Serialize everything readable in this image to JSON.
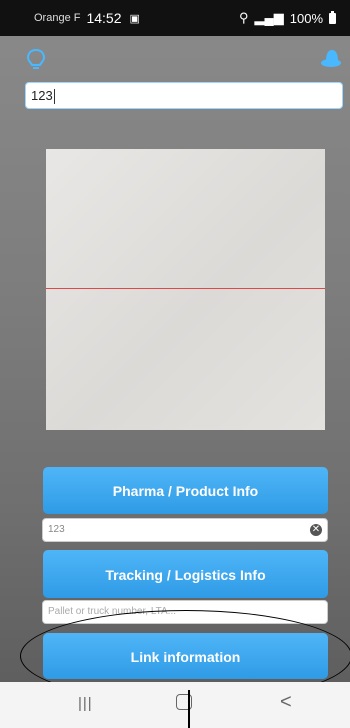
{
  "status_bar": {
    "carrier": "Orange F",
    "time": "14:52",
    "notification_icon": "notification-icon",
    "battery": "100%"
  },
  "header": {
    "left_icon": "lightbulb-icon",
    "right_icon": "hat-icon"
  },
  "code_input": {
    "value": "123"
  },
  "scanner": {
    "scan_line_color": "#e04848"
  },
  "buttons": {
    "pharma_label": "Pharma / Product Info",
    "tracking_label": "Tracking / Logistics Info",
    "link_label": "Link information"
  },
  "product_field": {
    "value": "123",
    "clear_icon": "clear-icon"
  },
  "tracking_field": {
    "placeholder": "Pallet or truck number, LTA..."
  },
  "nav_bar": {
    "recent_label": "|||",
    "back_label": "<"
  },
  "colors": {
    "button": "#3aa6ee",
    "accent": "#9dd7ff"
  }
}
